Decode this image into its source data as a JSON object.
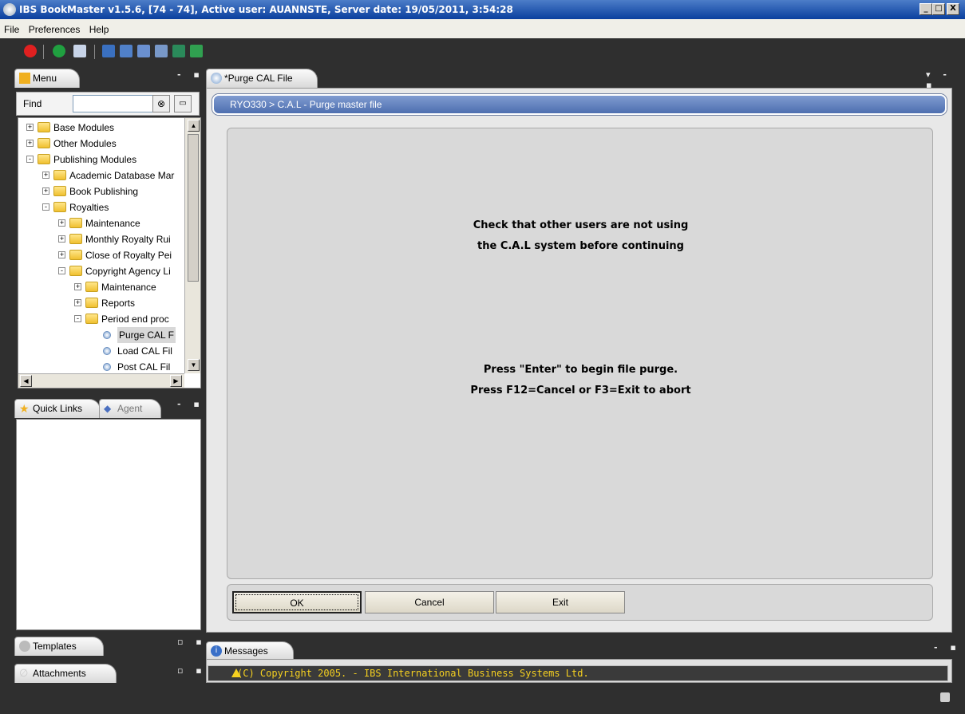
{
  "window": {
    "title": "IBS BookMaster v1.5.6,  [74 - 74], Active user: AUANNSTE, Server date: 19/05/2011, 3:54:28",
    "min": "_",
    "max": "□",
    "close": "X"
  },
  "menu": {
    "items": [
      "File",
      "Preferences",
      "Help"
    ]
  },
  "toolbar": {
    "icons": [
      "power-icon",
      "refresh-icon",
      "print-icon",
      "screen-icon",
      "screen2-icon",
      "search-icon",
      "person-search-icon",
      "play-icon",
      "check-icon"
    ]
  },
  "leftpanel": {
    "menu_tab": "Menu",
    "find_label": "Find",
    "find_value": "",
    "tree": [
      {
        "label": "Base Modules",
        "level": 0,
        "type": "folder",
        "state": "+"
      },
      {
        "label": "Other Modules",
        "level": 0,
        "type": "folder",
        "state": "+"
      },
      {
        "label": "Publishing Modules",
        "level": 0,
        "type": "folder",
        "state": "-"
      },
      {
        "label": "Academic Database Mar",
        "level": 1,
        "type": "folder",
        "state": "+"
      },
      {
        "label": "Book Publishing",
        "level": 1,
        "type": "folder",
        "state": "+"
      },
      {
        "label": "Royalties",
        "level": 1,
        "type": "folder",
        "state": "-"
      },
      {
        "label": "Maintenance",
        "level": 2,
        "type": "folder",
        "state": "+"
      },
      {
        "label": "Monthly Royalty Rui",
        "level": 2,
        "type": "folder",
        "state": "+"
      },
      {
        "label": "Close of Royalty Pei",
        "level": 2,
        "type": "folder",
        "state": "+"
      },
      {
        "label": "Copyright Agency Li",
        "level": 2,
        "type": "folder",
        "state": "-"
      },
      {
        "label": "Maintenance",
        "level": 3,
        "type": "folder",
        "state": "+"
      },
      {
        "label": "Reports",
        "level": 3,
        "type": "folder",
        "state": "+"
      },
      {
        "label": "Period end proc",
        "level": 3,
        "type": "folder",
        "state": "-"
      },
      {
        "label": "Purge CAL F",
        "level": 4,
        "type": "leaf",
        "state": "",
        "selected": true
      },
      {
        "label": "Load CAL Fil",
        "level": 4,
        "type": "leaf",
        "state": ""
      },
      {
        "label": "Post CAL Fil",
        "level": 4,
        "type": "leaf",
        "state": ""
      }
    ],
    "quicklinks_tab": "Quick Links",
    "agent_tab": "Agent",
    "templates_tab": "Templates",
    "attachments_tab": "Attachments"
  },
  "editor": {
    "tab": "*Purge CAL File",
    "breadcrumb": "RYO330 > C.A.L - Purge master file",
    "message1": "Check that other users are not using",
    "message2": "the C.A.L system before continuing",
    "message3": "Press \"Enter\" to begin file purge.",
    "message4": "Press F12=Cancel or F3=Exit to abort",
    "ok": "OK",
    "cancel": "Cancel",
    "exit": "Exit"
  },
  "messages": {
    "tab": "Messages",
    "line": "(C) Copyright 2005. - IBS International Business Systems Ltd."
  }
}
